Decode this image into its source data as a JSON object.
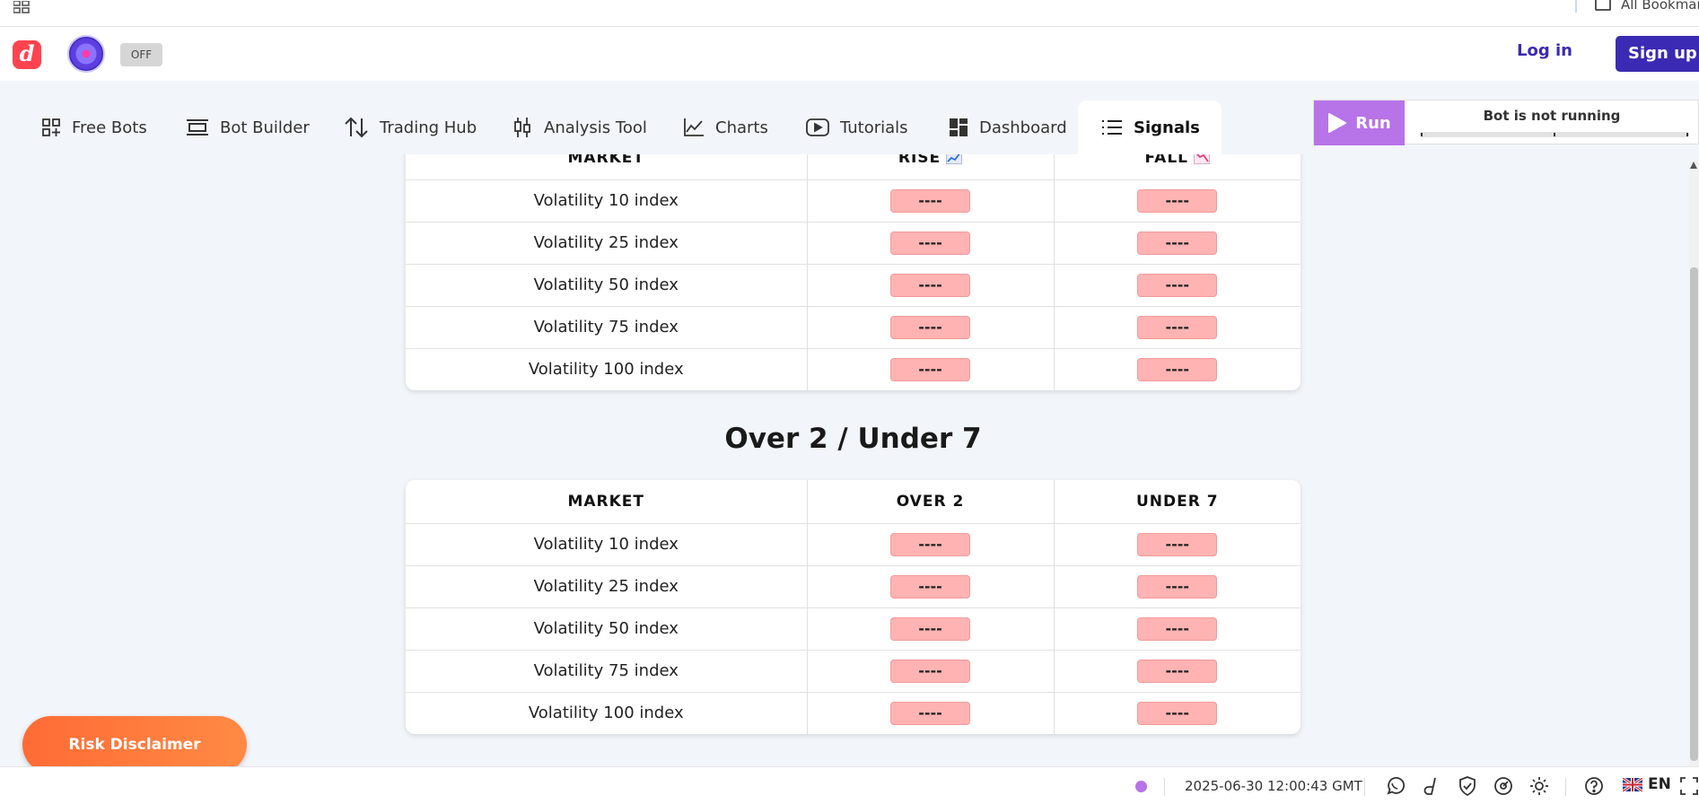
{
  "browser": {
    "bookmarks_label": "All Bookmarks"
  },
  "header": {
    "logo_letter": "d",
    "toggle_label": "OFF",
    "login_label": "Log in",
    "signup_label": "Sign up"
  },
  "nav": {
    "tabs": [
      {
        "label": "Free Bots",
        "icon": "grid-plus-icon"
      },
      {
        "label": "Bot Builder",
        "icon": "bot-builder-icon"
      },
      {
        "label": "Trading Hub",
        "icon": "up-down-arrows-icon"
      },
      {
        "label": "Analysis Tool",
        "icon": "candlestick-icon"
      },
      {
        "label": "Charts",
        "icon": "line-chart-icon"
      },
      {
        "label": "Tutorials",
        "icon": "play-icon"
      },
      {
        "label": "Dashboard",
        "icon": "dashboard-icon"
      },
      {
        "label": "Signals",
        "icon": "list-icon",
        "active": true
      }
    ]
  },
  "run_panel": {
    "run_label": "Run",
    "status": "Bot is not running",
    "progress": 0
  },
  "rise_fall_table": {
    "headers": [
      "MARKET",
      "RISE",
      "FALL"
    ],
    "rows": [
      {
        "market": "Volatility 10 index",
        "a": "----",
        "b": "----"
      },
      {
        "market": "Volatility 25 index",
        "a": "----",
        "b": "----"
      },
      {
        "market": "Volatility 50 index",
        "a": "----",
        "b": "----"
      },
      {
        "market": "Volatility 75 index",
        "a": "----",
        "b": "----"
      },
      {
        "market": "Volatility 100 index",
        "a": "----",
        "b": "----"
      }
    ]
  },
  "over_under": {
    "title": "Over 2 / Under 7",
    "headers": [
      "MARKET",
      "OVER 2",
      "UNDER 7"
    ],
    "rows": [
      {
        "market": "Volatility 10 index",
        "a": "----",
        "b": "----"
      },
      {
        "market": "Volatility 25 index",
        "a": "----",
        "b": "----"
      },
      {
        "market": "Volatility 50 index",
        "a": "----",
        "b": "----"
      },
      {
        "market": "Volatility 75 index",
        "a": "----",
        "b": "----"
      },
      {
        "market": "Volatility 100 index",
        "a": "----",
        "b": "----"
      }
    ]
  },
  "risk_disclaimer_label": "Risk Disclaimer",
  "footer": {
    "datetime": "2025-06-30 12:00:43 GMT",
    "language": "EN"
  },
  "colors": {
    "accent": "#3b2ab3",
    "run": "#b773e8",
    "pill": "#ffb3b3",
    "risk": "#ff6b35",
    "brand": "#ff444f"
  }
}
